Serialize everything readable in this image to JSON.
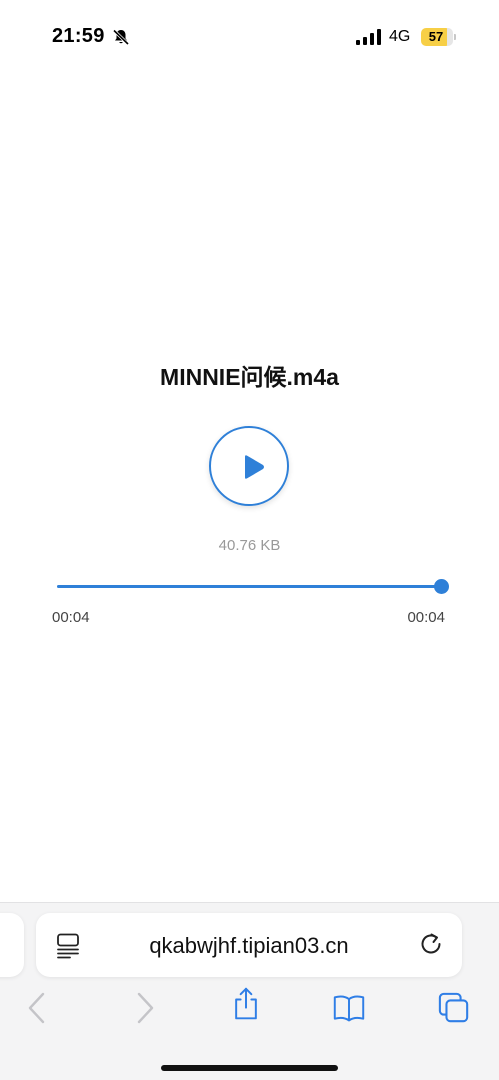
{
  "status_bar": {
    "time": "21:59",
    "network": "4G",
    "battery": "57",
    "icons": [
      "bell-slash-icon",
      "signal-bars-icon"
    ]
  },
  "player": {
    "title": "MINNIE问候.m4a",
    "file_size": "40.76 KB",
    "elapsed": "00:04",
    "total": "00:04",
    "progress": 1.0,
    "accent_color": "#2f80d8"
  },
  "browser": {
    "url": "qkabwjhf.tipian03.cn",
    "icons": [
      "reader-icon",
      "reload-icon",
      "back-icon",
      "forward-icon",
      "share-icon",
      "bookmarks-icon",
      "tabs-icon"
    ]
  }
}
